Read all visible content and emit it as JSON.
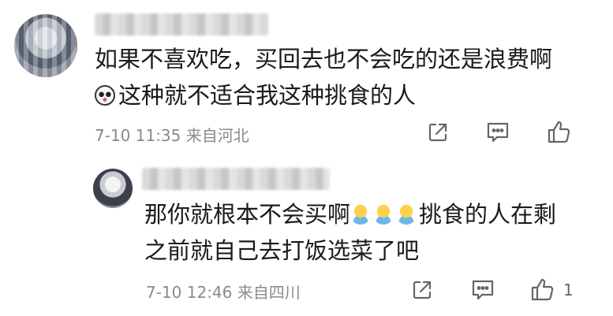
{
  "comment": {
    "text_lines": [
      "如果不喜欢吃，买回去也不会吃的还是浪费啊",
      "这种就不适合我这种挑食的人"
    ],
    "meta": "7-10 11:35  来自河北"
  },
  "reply": {
    "text_line1": "那你就根本不会买啊",
    "text_line1_tail": "挑食的人在剩",
    "text_line2": "之前就自己去打饭选菜了吧",
    "meta": "7-10 12:46  来自四川",
    "like_count": "1"
  }
}
